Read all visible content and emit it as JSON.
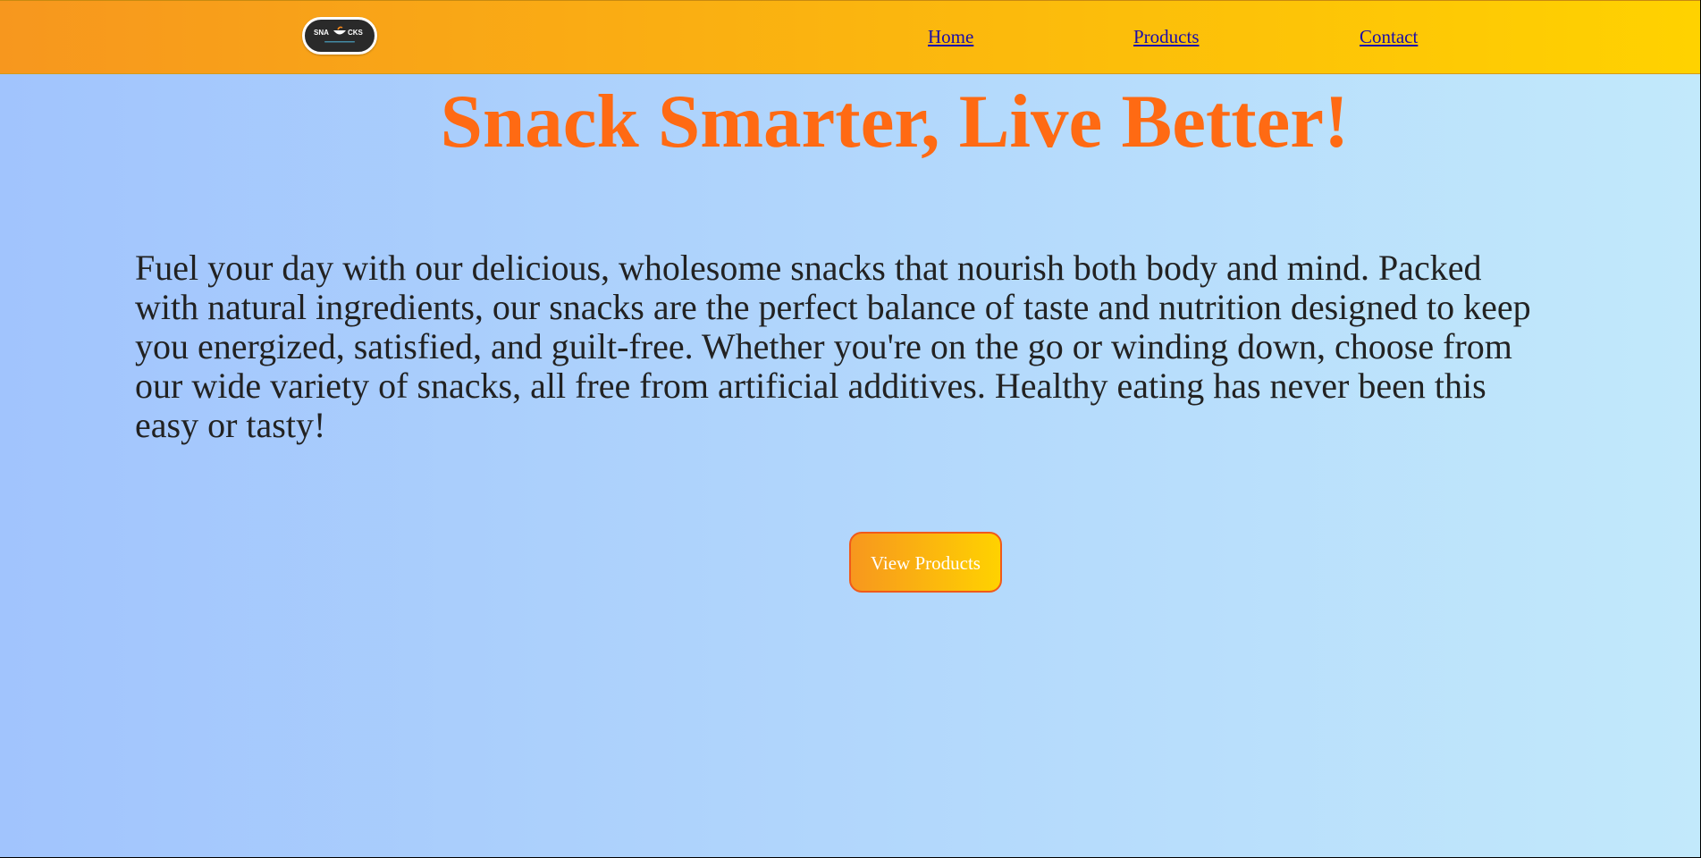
{
  "header": {
    "logo": {
      "text": "SNACKS",
      "tagline": "Healthy & Tasty"
    },
    "nav": {
      "home": "Home",
      "products": "Products",
      "contact": "Contact"
    }
  },
  "hero": {
    "title": "Snack Smarter, Live Better!",
    "description": "Fuel your day with our delicious, wholesome snacks that nourish both body and mind. Packed with natural ingredients, our snacks are the perfect balance of taste and nutrition designed to keep you energized, satisfied, and guilt-free. Whether you're on the go or winding down, choose from our wide variety of snacks, all free from artificial additives. Healthy eating has never been this easy or tasty!",
    "cta_label": "View Products"
  },
  "colors": {
    "header_gradient_start": "#f7971e",
    "header_gradient_end": "#ffd200",
    "page_gradient_start": "#a1c4fd",
    "page_gradient_end": "#c2e9fb",
    "title_color": "#ff6a13",
    "link_color": "#1a0dab",
    "button_border": "#f05a1a"
  },
  "icons": {
    "logo": "snack-bowl-icon"
  }
}
